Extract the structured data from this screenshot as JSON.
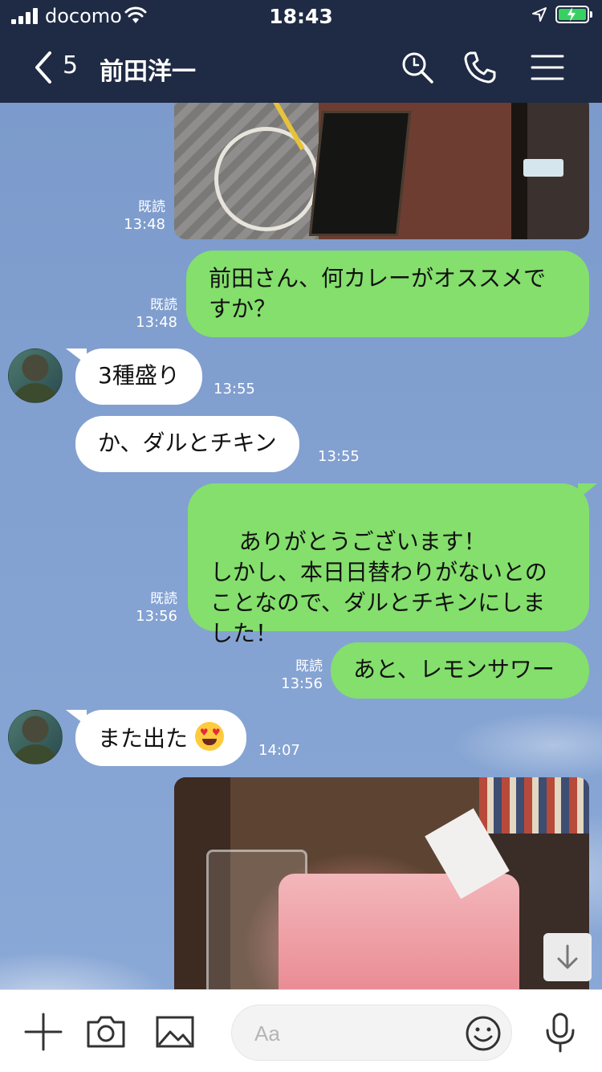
{
  "status_bar": {
    "carrier": "docomo",
    "time": "18:43"
  },
  "header": {
    "unread_count": "5",
    "title": "前田洋一"
  },
  "messages": [
    {
      "type": "image",
      "side": "me",
      "read": "既読",
      "time": "13:48"
    },
    {
      "type": "text",
      "side": "me",
      "text": "前田さん、何カレーがオススメですか？",
      "read": "既読",
      "time": "13:48"
    },
    {
      "type": "text",
      "side": "them",
      "text": "3種盛り",
      "time": "13:55"
    },
    {
      "type": "text",
      "side": "them",
      "text": "か、ダルとチキン",
      "time": "13:55"
    },
    {
      "type": "text",
      "side": "me",
      "text": "ありがとうございます！\nしかし、本日日替わりがないとのことなので、ダルとチキンにしました！",
      "read": "既読",
      "time": "13:56"
    },
    {
      "type": "text",
      "side": "me",
      "text": "あと、レモンサワー",
      "read": "既読",
      "time": "13:56"
    },
    {
      "type": "text",
      "side": "them",
      "text": "また出た",
      "emoji": "heart-eyes",
      "time": "14:07"
    },
    {
      "type": "image",
      "side": "me"
    }
  ],
  "composer": {
    "placeholder": "Aa"
  },
  "icons": [
    "back-chevron-icon",
    "search-icon",
    "phone-icon",
    "menu-icon",
    "plus-icon",
    "camera-icon",
    "image-icon",
    "emoji-icon",
    "microphone-icon",
    "arrow-down-icon"
  ],
  "colors": {
    "header_bg": "#1f2a44",
    "my_bubble": "#84df6c",
    "their_bubble": "#ffffff",
    "chat_bg": "#7e9fcf"
  }
}
